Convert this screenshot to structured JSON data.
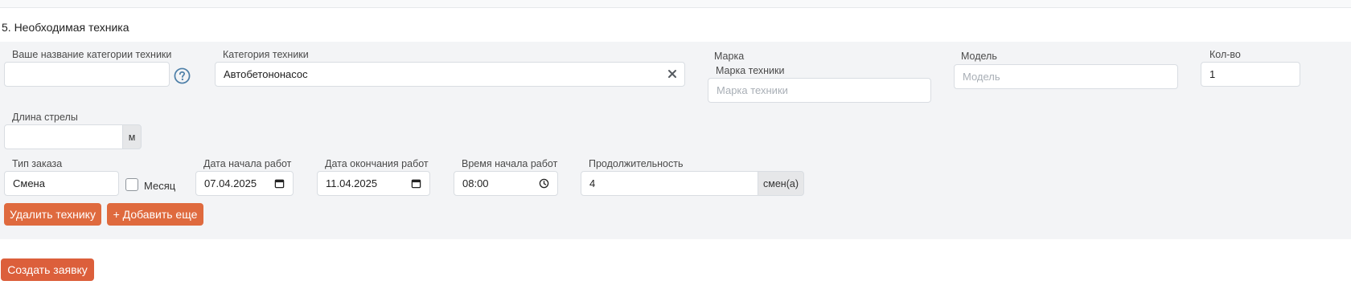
{
  "section": {
    "title": "5. Необходимая техника"
  },
  "fields": {
    "custom_category": {
      "label": "Ваше название категории техники",
      "value": ""
    },
    "category": {
      "label": "Категория техники",
      "value": "Автобетононасос"
    },
    "brand": {
      "label": "Марка",
      "sublabel": "Марка техники",
      "placeholder": "Марка техники"
    },
    "model": {
      "label": "Модель",
      "placeholder": "Модель"
    },
    "quantity": {
      "label": "Кол-во",
      "value": "1"
    },
    "boom_length": {
      "label": "Длина стрелы",
      "value": "",
      "unit": "м"
    },
    "order_type": {
      "label": "Тип заказа",
      "value": "Смена"
    },
    "month": {
      "label": "Месяц",
      "checked": false
    },
    "start_date": {
      "label": "Дата начала работ",
      "value": "07.04.2025"
    },
    "end_date": {
      "label": "Дата окончания работ",
      "value": "11.04.2025"
    },
    "start_time": {
      "label": "Время начала работ",
      "value": "08:00"
    },
    "duration": {
      "label": "Продолжительность",
      "value": "4",
      "unit": "смен(а)"
    }
  },
  "buttons": {
    "delete": "Удалить технику",
    "add_more": "+ Добавить еще",
    "create": "Создать заявку"
  },
  "colors": {
    "accent": "#df6a3e",
    "panel_bg": "#f3f4f6",
    "help_icon": "#4d7fa8"
  },
  "icons": {
    "help": "question-circle-icon",
    "clear": "close-icon",
    "date_picker": "calendar-icon",
    "time_picker": "clock-icon"
  }
}
